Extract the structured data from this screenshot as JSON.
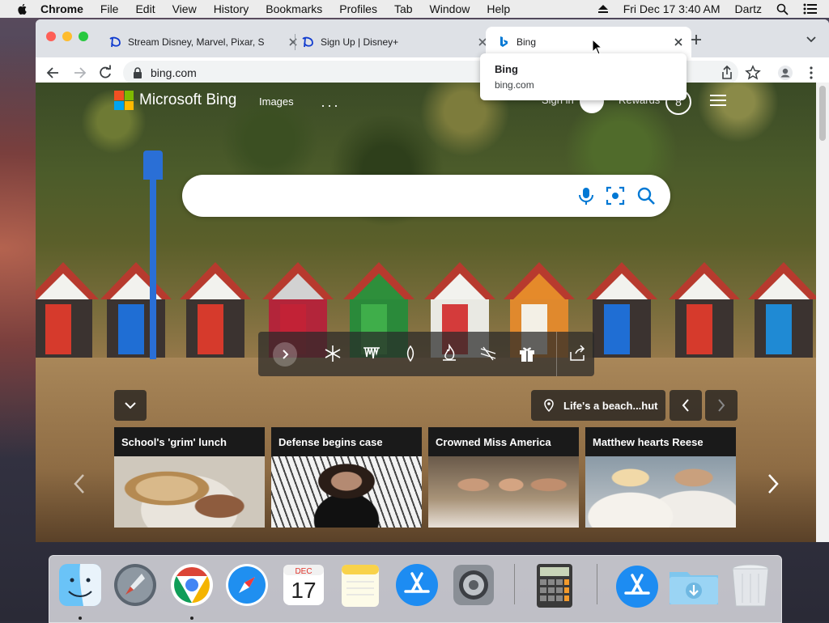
{
  "menubar": {
    "app": "Chrome",
    "items": [
      "File",
      "Edit",
      "View",
      "History",
      "Bookmarks",
      "Profiles",
      "Tab",
      "Window",
      "Help"
    ],
    "datetime": "Fri Dec 17  3:40 AM",
    "user": "Dartz"
  },
  "browser": {
    "tabs": [
      {
        "title": "Stream Disney, Marvel, Pixar, S",
        "icon": "disney-plus-icon"
      },
      {
        "title": "Sign Up | Disney+",
        "icon": "disney-plus-icon"
      },
      {
        "title": "Bing",
        "icon": "bing-icon",
        "active": true
      }
    ],
    "url": "bing.com",
    "hovercard": {
      "title": "Bing",
      "url": "bing.com"
    }
  },
  "bing": {
    "logo_text": "Microsoft Bing",
    "nav": {
      "images": "Images",
      "more": "···",
      "signin": "Sign in",
      "rewards": "Rewards",
      "rewards_count": "8"
    },
    "search": {
      "value": "",
      "placeholder": ""
    },
    "caption": "Life's a beach...hut",
    "news": [
      {
        "title": "School's 'grim' lunch"
      },
      {
        "title": "Defense begins case"
      },
      {
        "title": "Crowned Miss America"
      },
      {
        "title": "Matthew hearts Reese"
      }
    ]
  },
  "dock": {
    "calendar_month": "DEC",
    "calendar_day": "17"
  },
  "colors": {
    "ms_red": "#f25022",
    "ms_green": "#7fba00",
    "ms_blue": "#00a4ef",
    "ms_yellow": "#ffb900",
    "bing_blue": "#0078d4",
    "chrome_frame": "#dee1e6"
  }
}
